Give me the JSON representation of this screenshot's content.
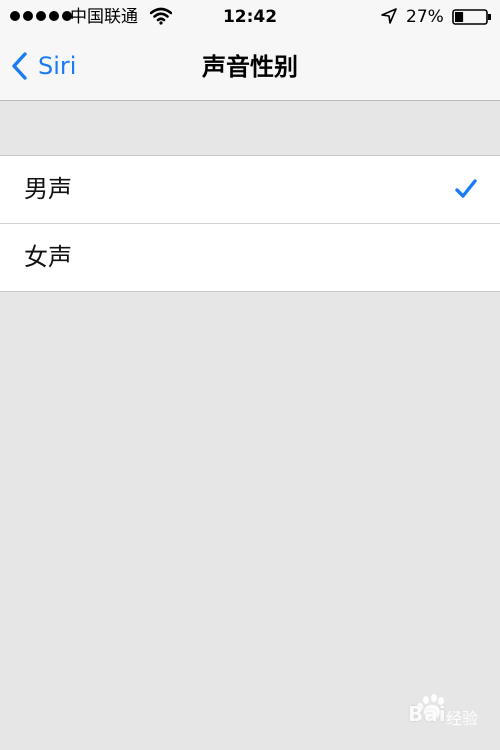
{
  "status_bar": {
    "carrier": "中国联通",
    "time": "12:42",
    "battery_percent": "27%",
    "battery_level": 0.27,
    "signal_bars": 5,
    "icons": [
      "signal-dots-icon",
      "wifi-icon",
      "location-arrow-icon",
      "battery-icon"
    ]
  },
  "nav": {
    "back_label": "Siri",
    "title": "声音性别",
    "back_icon": "chevron-left-icon"
  },
  "options": [
    {
      "label": "男声",
      "selected": true
    },
    {
      "label": "女声",
      "selected": false
    }
  ],
  "colors": {
    "accent": "#1a7cf5",
    "background": "#e6e6e6",
    "bar_background": "#f7f7f7",
    "cell_background": "#ffffff"
  },
  "watermark": {
    "logo": "baidu-paw-logo",
    "brand": "Bai",
    "sub": "经验"
  }
}
